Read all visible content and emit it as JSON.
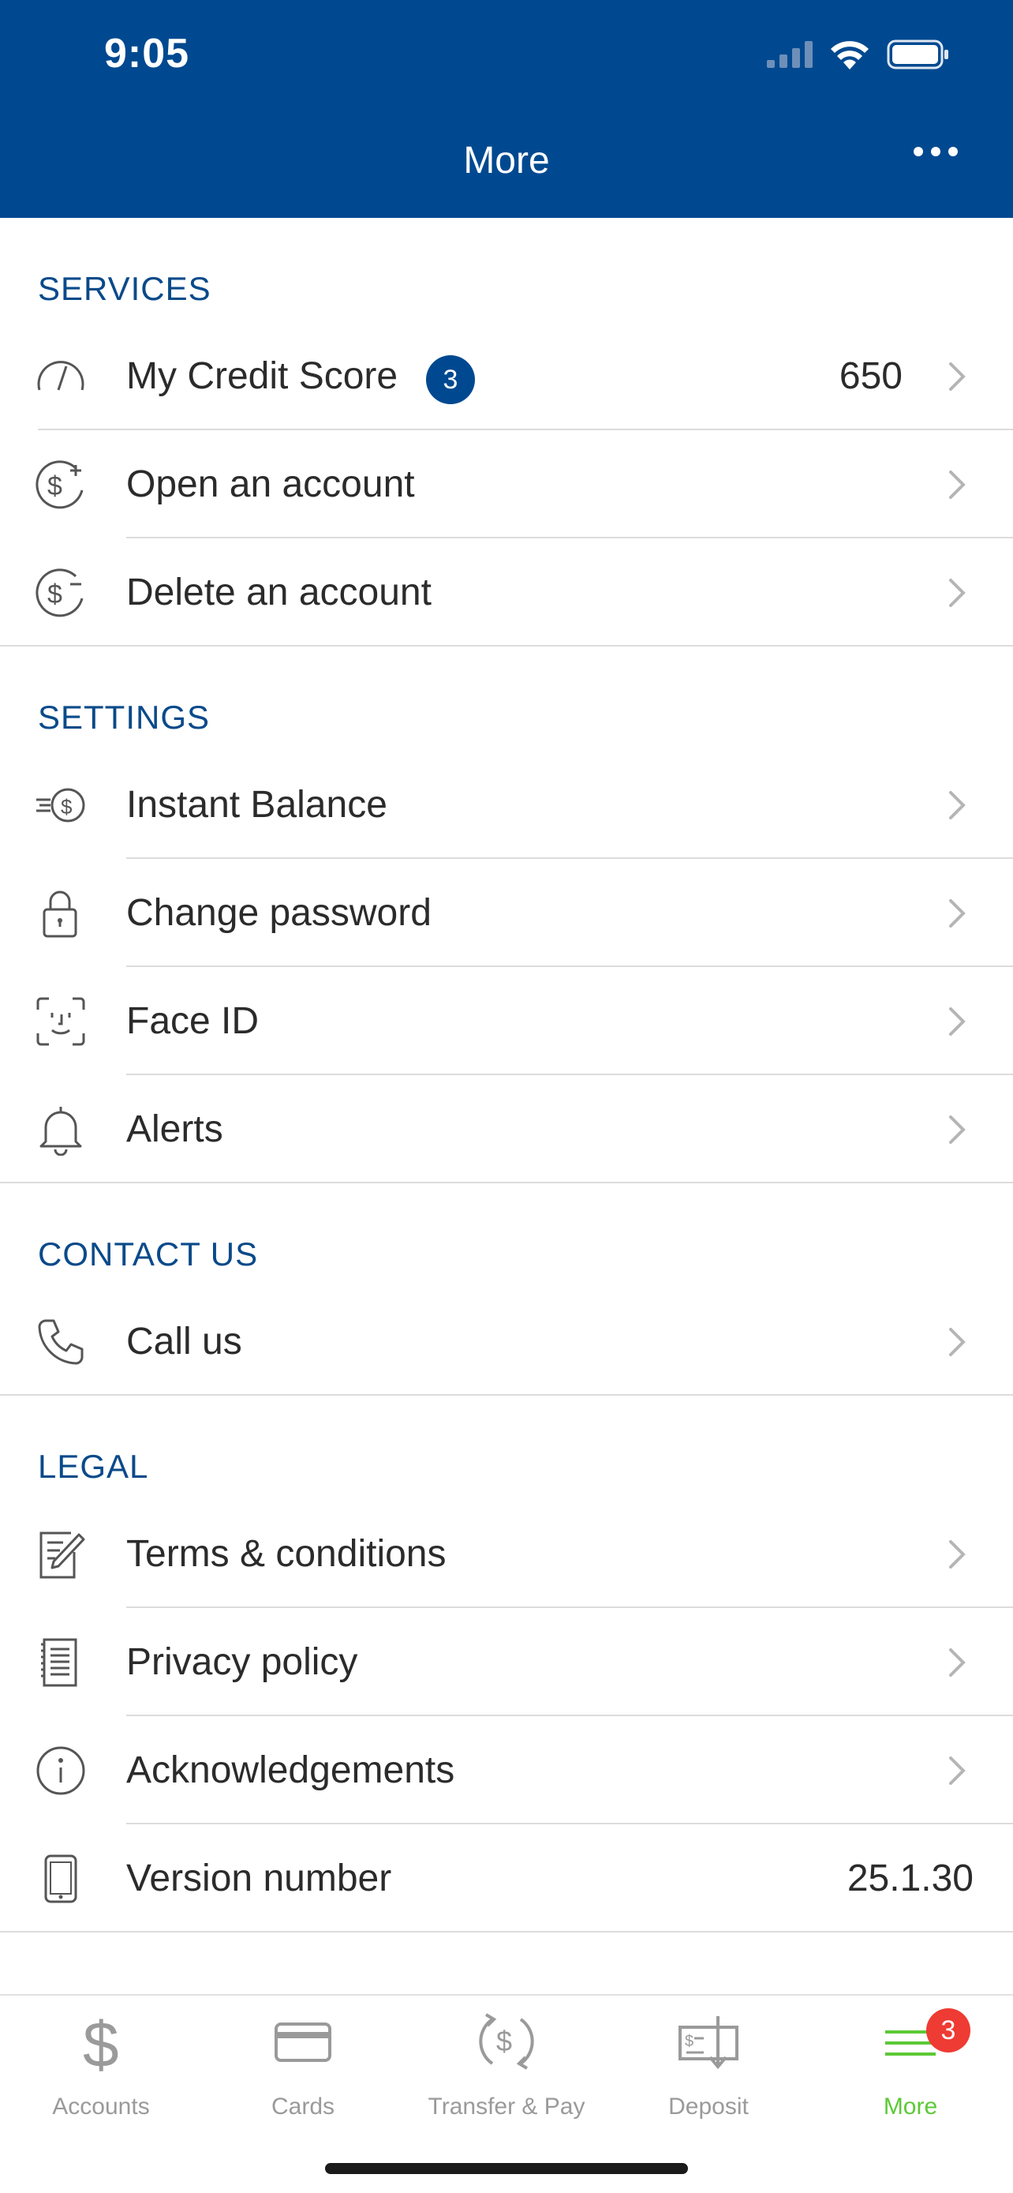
{
  "status_bar": {
    "time": "9:05"
  },
  "nav": {
    "title": "More"
  },
  "sections": {
    "services": {
      "title": "SERVICES",
      "credit_score": {
        "label": "My Credit Score",
        "badge": "3",
        "value": "650"
      },
      "open_account": {
        "label": "Open an account"
      },
      "delete_account": {
        "label": "Delete an account"
      }
    },
    "settings": {
      "title": "SETTINGS",
      "instant_balance": {
        "label": "Instant Balance"
      },
      "change_password": {
        "label": "Change password"
      },
      "face_id": {
        "label": "Face ID"
      },
      "alerts": {
        "label": "Alerts"
      }
    },
    "contact": {
      "title": "CONTACT US",
      "call_us": {
        "label": "Call us"
      }
    },
    "legal": {
      "title": "LEGAL",
      "terms": {
        "label": "Terms & conditions"
      },
      "privacy": {
        "label": "Privacy policy"
      },
      "acknowledgements": {
        "label": "Acknowledgements"
      },
      "version": {
        "label": "Version number",
        "value": "25.1.30"
      }
    }
  },
  "tabbar": {
    "accounts": "Accounts",
    "cards": "Cards",
    "transfer": "Transfer & Pay",
    "deposit": "Deposit",
    "more": "More",
    "more_badge": "3"
  },
  "colors": {
    "header_bg": "#004990",
    "section_title": "#0a4a8a",
    "active_tab": "#5cc936",
    "badge_red": "#ee3b33"
  }
}
